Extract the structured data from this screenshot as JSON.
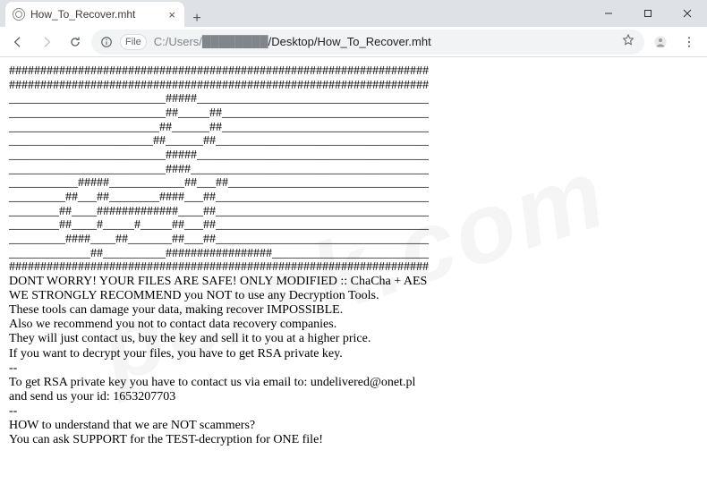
{
  "window": {
    "tab_title": "How_To_Recover.mht",
    "minimize": "–",
    "maximize": "□",
    "close": "×",
    "newtab": "+"
  },
  "toolbar": {
    "file_chip": "File",
    "path_prefix": "C:/Users/",
    "path_suffix": "/Desktop/How_To_Recover.mht"
  },
  "ascii": [
    "###################################################################",
    "###################################################################",
    "_________________________#####_____________________________________",
    "_________________________##_____##_________________________________",
    "________________________##______##_________________________________",
    "_______________________##______##__________________________________",
    "_________________________#####_____________________________________",
    "_________________________####______________________________________",
    "___________#####____________##___##________________________________",
    "_________##___##________####___##__________________________________",
    "________##____#############____##__________________________________",
    "________##____#_____#_____##___##__________________________________",
    "_________####____##_______##___##__________________________________",
    "_____________##__________#################_________________________",
    "###################################################################"
  ],
  "body": [
    "DONT WORRY! YOUR FILES ARE SAFE! ONLY MODIFIED :: ChaCha + AES",
    "WE STRONGLY RECOMMEND you NOT to use any Decryption Tools.",
    "These tools can damage your data, making recover IMPOSSIBLE.",
    "Also we recommend you not to contact data recovery companies.",
    "They will just contact us, buy the key and sell it to you at a higher price.",
    "If you want to decrypt your files, you have to get RSA private key.",
    "--",
    "To get RSA private key you have to contact us via email to: undelivered@onet.pl",
    "and send us your id: 1653207703",
    "--",
    "HOW to understand that we are NOT scammers?",
    "You can ask SUPPORT for the TEST-decryption for ONE file!"
  ],
  "watermark": "pcrsk.com"
}
